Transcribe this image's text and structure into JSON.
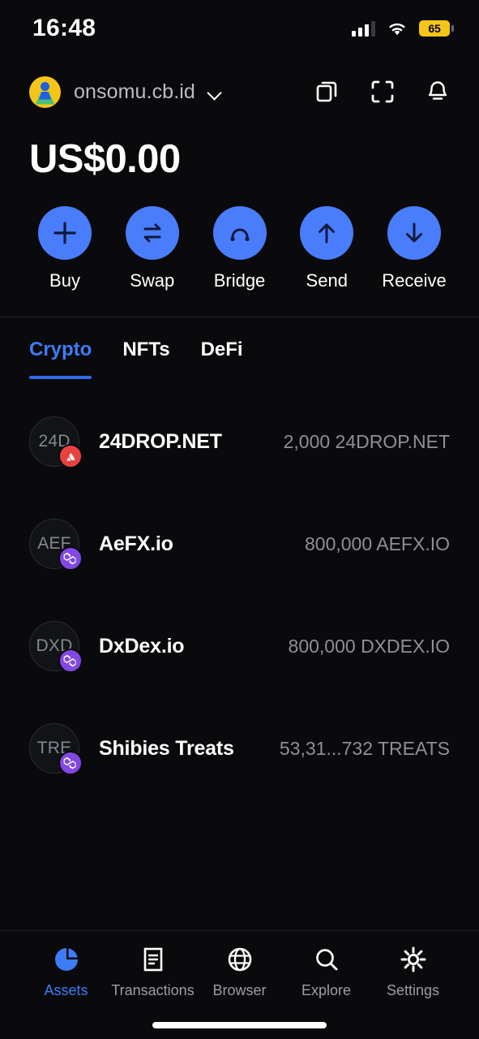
{
  "status_bar": {
    "time": "16:48",
    "battery_level": "65",
    "signal_icon": "cellular-signal-icon",
    "wifi_icon": "wifi-icon",
    "battery_icon": "battery-icon",
    "battery_color": "#f5c518"
  },
  "header": {
    "account_name": "onsomu.cb.id",
    "avatar_icon": "avatar",
    "chevron_icon": "chevron-down-icon",
    "copy_icon": "copy-icon",
    "scan_icon": "qr-scan-icon",
    "bell_icon": "bell-icon"
  },
  "balance": {
    "total": "US$0.00"
  },
  "actions": [
    {
      "label": "Buy",
      "icon": "plus-icon"
    },
    {
      "label": "Swap",
      "icon": "swap-icon"
    },
    {
      "label": "Bridge",
      "icon": "bridge-icon"
    },
    {
      "label": "Send",
      "icon": "arrow-up-icon"
    },
    {
      "label": "Receive",
      "icon": "arrow-down-icon"
    }
  ],
  "accent_color": "#3d7cf7",
  "action_button_color": "#4a7dfc",
  "tabs": [
    {
      "label": "Crypto",
      "active": true
    },
    {
      "label": "NFTs",
      "active": false
    },
    {
      "label": "DeFi",
      "active": false
    }
  ],
  "tokens": [
    {
      "initials": "24D",
      "name": "24DROP.NET",
      "amount": "2,000 24DROP.NET",
      "chain": "avalanche",
      "chain_color": "#e84142"
    },
    {
      "initials": "AEF",
      "name": "AeFX.io",
      "amount": "800,000 AEFX.IO",
      "chain": "polygon",
      "chain_color": "#8247e5"
    },
    {
      "initials": "DXD",
      "name": "DxDex.io",
      "amount": "800,000 DXDEX.IO",
      "chain": "polygon",
      "chain_color": "#8247e5"
    },
    {
      "initials": "TRE",
      "name": "Shibies Treats",
      "amount": "53,31...732 TREATS",
      "chain": "polygon",
      "chain_color": "#8247e5"
    }
  ],
  "bottom_nav": [
    {
      "label": "Assets",
      "icon": "pie-chart-icon",
      "active": true
    },
    {
      "label": "Transactions",
      "icon": "document-icon",
      "active": false
    },
    {
      "label": "Browser",
      "icon": "globe-icon",
      "active": false
    },
    {
      "label": "Explore",
      "icon": "search-icon",
      "active": false
    },
    {
      "label": "Settings",
      "icon": "gear-icon",
      "active": false
    }
  ]
}
